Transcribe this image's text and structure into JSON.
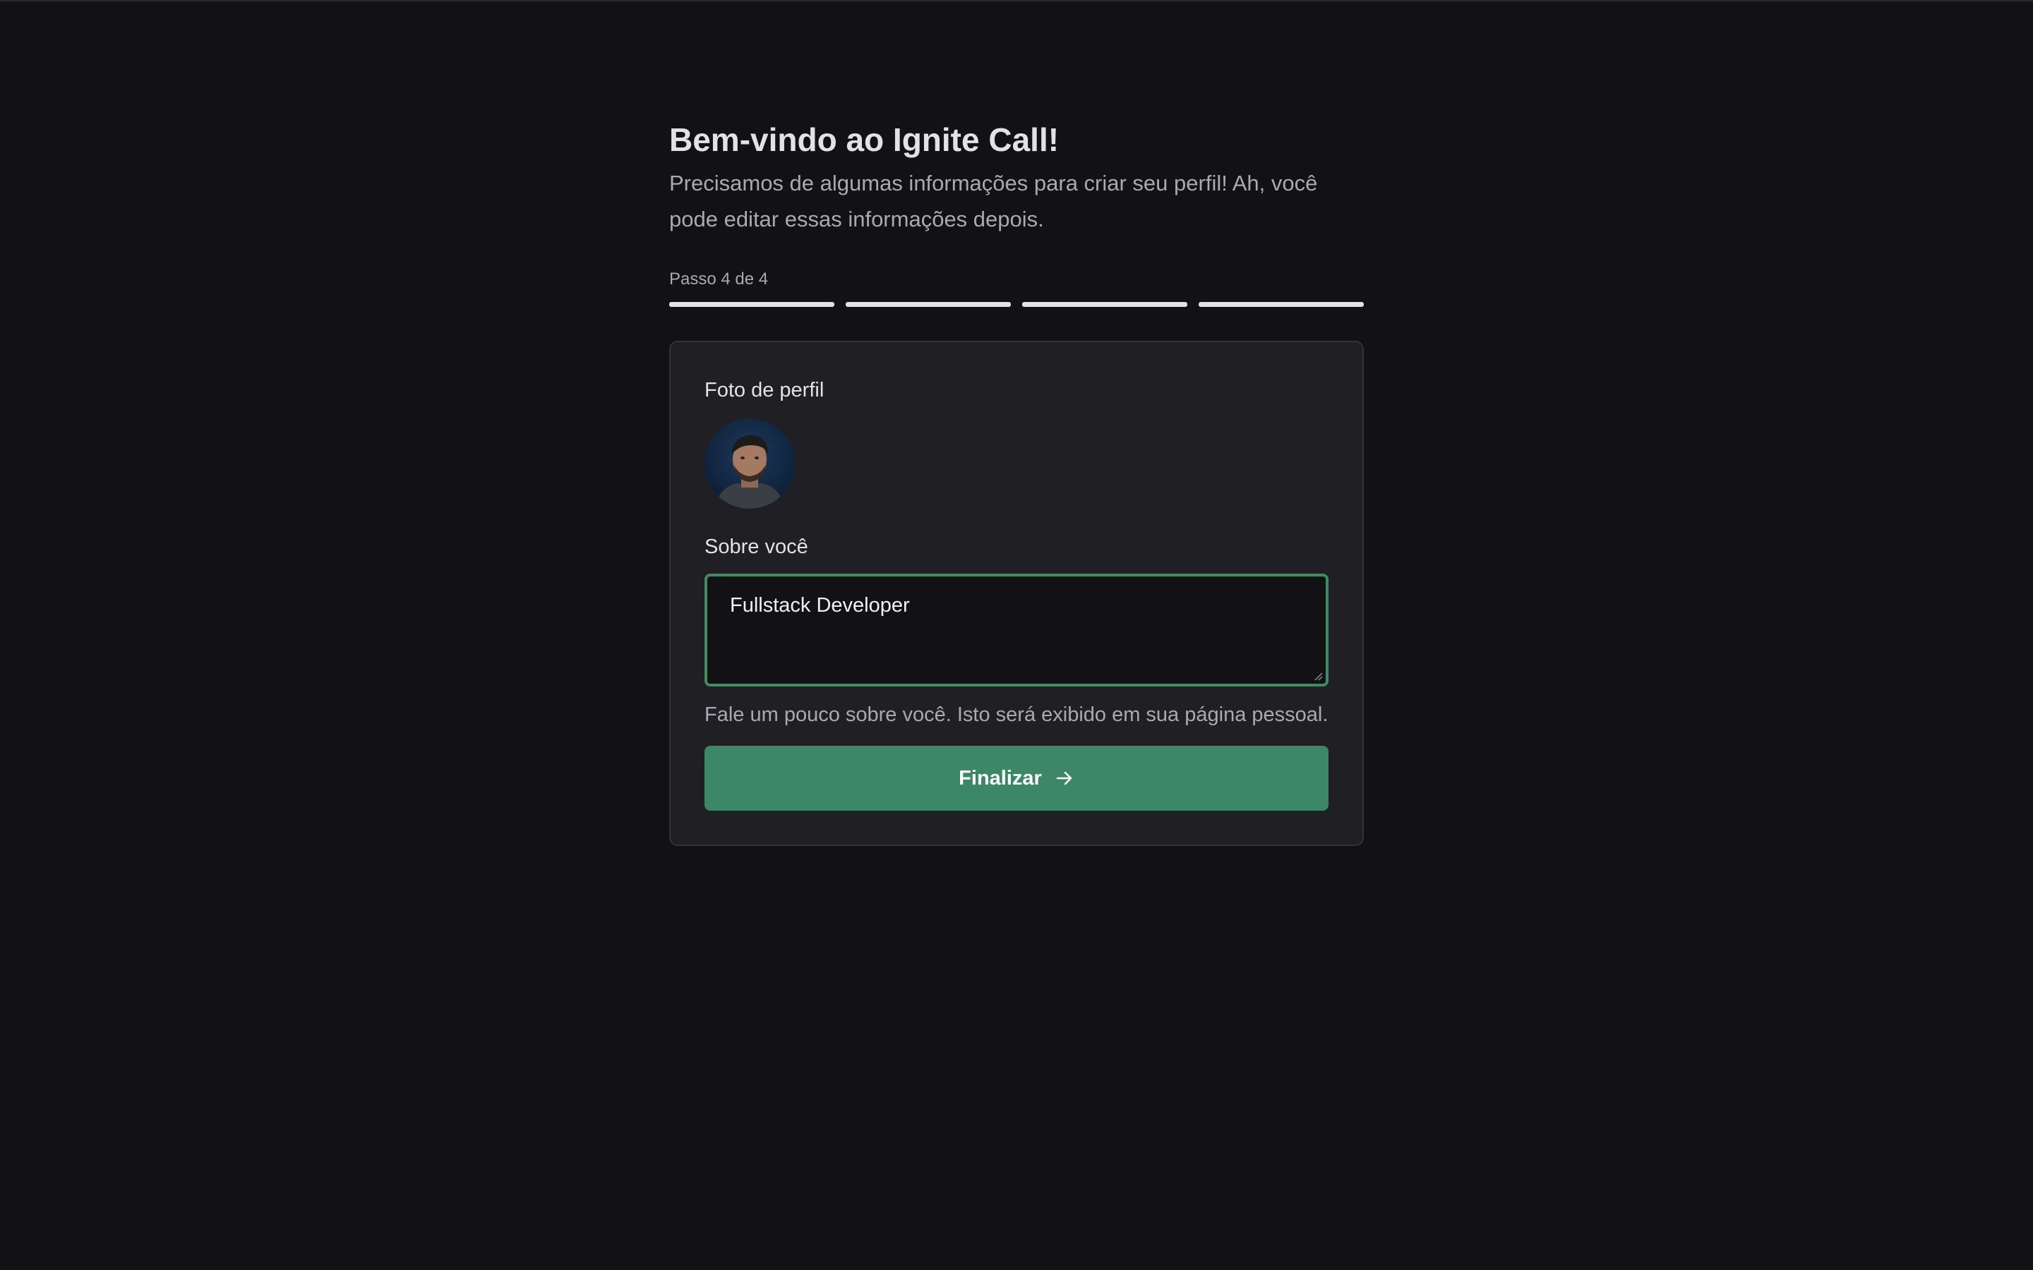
{
  "header": {
    "title": "Bem-vindo ao Ignite Call!",
    "subtitle": "Precisamos de algumas informações para criar seu perfil! Ah, você pode editar essas informações depois."
  },
  "progress": {
    "label": "Passo 4 de 4",
    "current_step": 4,
    "total_steps": 4
  },
  "form": {
    "photo_label": "Foto de perfil",
    "about_label": "Sobre você",
    "about_value": "Fullstack Developer",
    "about_hint": "Fale um pouco sobre você. Isto será exibido em sua página pessoal.",
    "submit_label": "Finalizar",
    "submit_icon": "arrow-right-icon"
  },
  "colors": {
    "background": "#121214",
    "card": "#202024",
    "accent": "#3c8766",
    "focus_border": "#3d8c64"
  }
}
